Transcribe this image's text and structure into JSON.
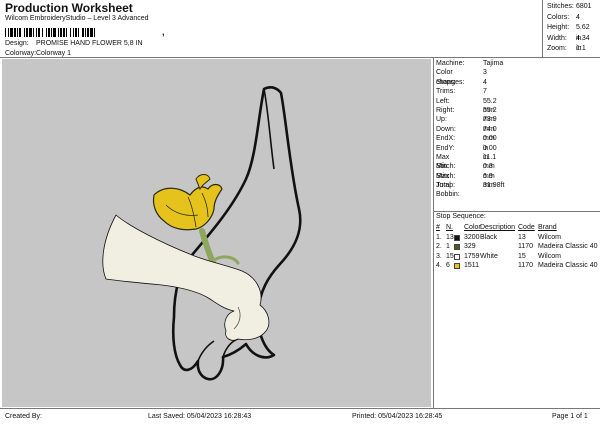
{
  "header": {
    "title": "Production Worksheet",
    "subtitle": "Wilcom EmbroideryStudio – Level 3 Advanced",
    "barcode_symbol": ","
  },
  "details": [
    {
      "label": "Design:",
      "value": "PROMISE HAND FLOWER 5,8 IN"
    },
    {
      "label": "Colorway:",
      "value": "Colorway 1"
    }
  ],
  "stats": [
    {
      "label": "Stitches:",
      "value": "6801"
    },
    {
      "label": "Colors:",
      "value": "4"
    },
    {
      "label": "Height:",
      "value": "5.62 in"
    },
    {
      "label": "Width:",
      "value": "4.34 in"
    },
    {
      "label": "Zoom:",
      "value": "1:1"
    }
  ],
  "machine_info": [
    {
      "label": "Machine:",
      "value": "Tajima"
    },
    {
      "label": "Color changes:",
      "value": "3"
    },
    {
      "label": "Stops:",
      "value": "4"
    },
    {
      "label": "Trims:",
      "value": "7"
    },
    {
      "label": "Left:",
      "value": "55.2 mm"
    },
    {
      "label": "Right:",
      "value": "55.2 mm"
    },
    {
      "label": "Up:",
      "value": "73.9 mm"
    },
    {
      "label": "Down:",
      "value": "74.0 mm"
    },
    {
      "label": "EndX:",
      "value": "0.00 in"
    },
    {
      "label": "EndY:",
      "value": "0.00 in"
    },
    {
      "label": "Max Stitch:",
      "value": "11.1 mm"
    },
    {
      "label": "Min Stitch:",
      "value": "0.3 mm"
    },
    {
      "label": "Max Jump:",
      "value": "6.9 mm"
    },
    {
      "label": "Total Bobbin:",
      "value": "31.98ft"
    }
  ],
  "stop_sequence": {
    "title": "Stop Sequence:",
    "headers": {
      "n": "#",
      "stop": "N.",
      "color": "Color",
      "description": "Description",
      "code": "Code",
      "brand": "Brand"
    },
    "rows": [
      {
        "n": "1.",
        "stop": "13",
        "swatch": "#111111",
        "color": "3200",
        "description": "Black",
        "code": "13",
        "brand": "Wilcom"
      },
      {
        "n": "2.",
        "stop": "1",
        "swatch": "#4a5a26",
        "color": "329",
        "description": "",
        "code": "1170",
        "brand": "Madeira Classic 40"
      },
      {
        "n": "3.",
        "stop": "15",
        "swatch": "#ffffff",
        "color": "1759",
        "description": "White",
        "code": "15",
        "brand": "Wilcom"
      },
      {
        "n": "4.",
        "stop": "6",
        "swatch": "#e6c31c",
        "color": "1511",
        "description": "",
        "code": "1170",
        "brand": "Madeira Classic 40"
      }
    ]
  },
  "footer": {
    "created_by": "Created By:",
    "last_saved": "Last Saved: 05/04/2023 16:28:43",
    "printed": "Printed: 05/04/2023 16:28:45",
    "page": "Page 1 of 1"
  },
  "design_colors": {
    "canvas": "#c6c6c6",
    "outline": "#111111",
    "glove": "#f1efe2",
    "stem": "#8ea65e",
    "petal": "#e6c31c"
  }
}
